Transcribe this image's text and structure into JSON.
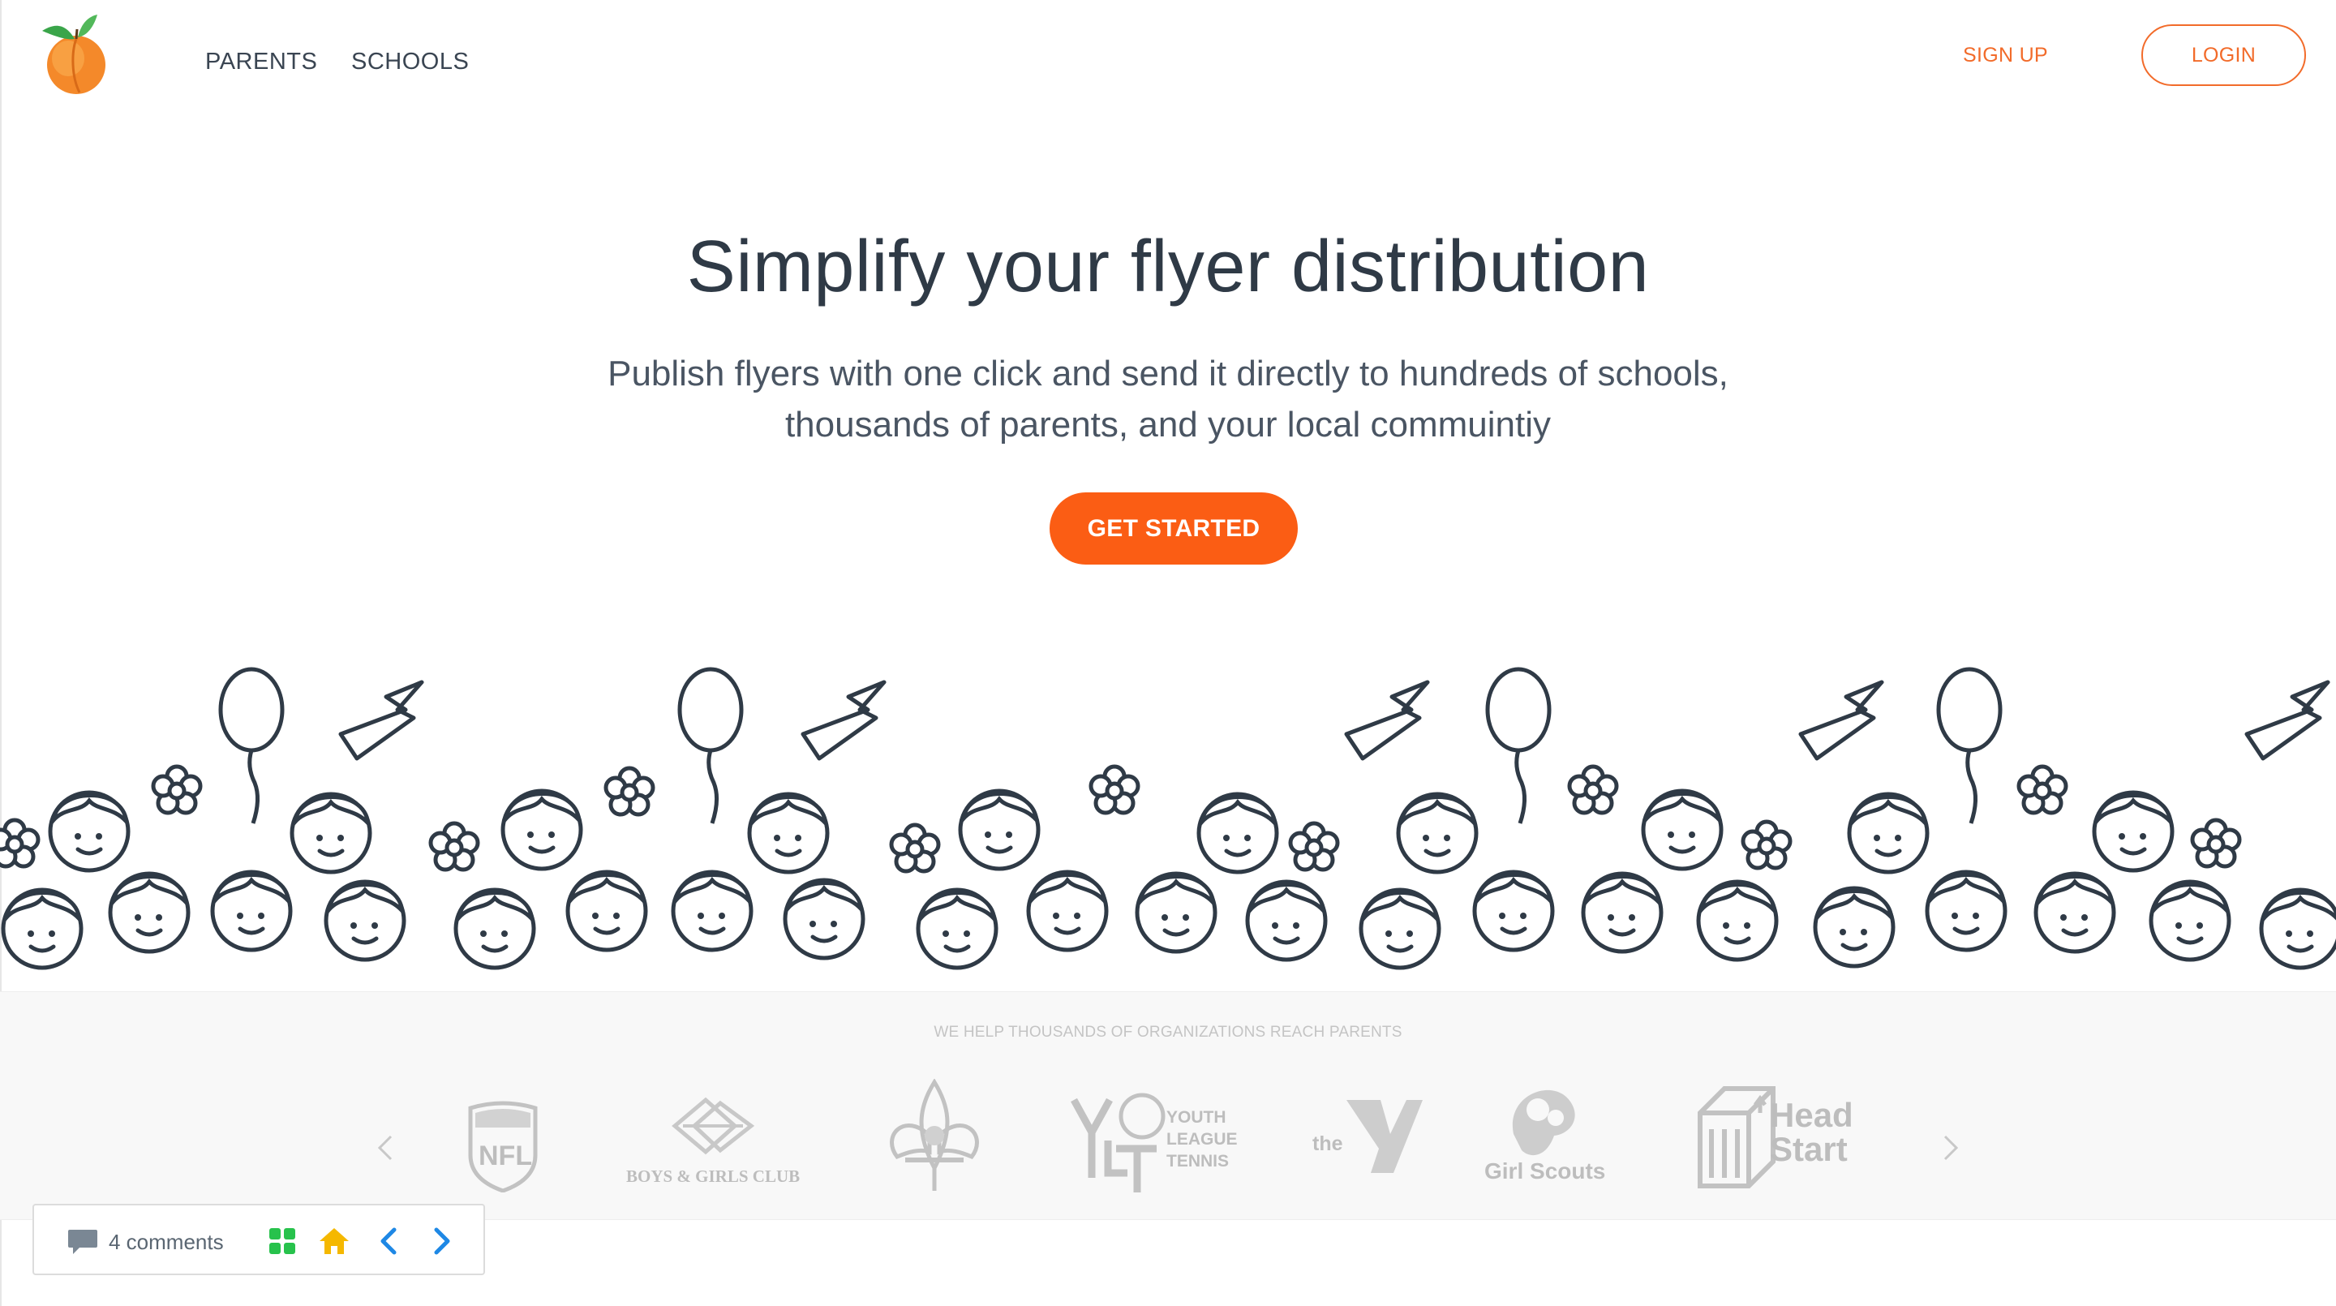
{
  "nav": {
    "links": [
      {
        "label": "PARENTS"
      },
      {
        "label": "SCHOOLS"
      }
    ],
    "signup_label": "SIGN UP",
    "login_label": "LOGIN"
  },
  "hero": {
    "title": "Simplify your flyer distribution",
    "subtitle_line1": "Publish flyers with one click and send it directly to hundreds of schools,",
    "subtitle_line2": "thousands of parents, and your local commuintiy",
    "cta_label": "GET STARTED"
  },
  "organizations": {
    "caption": "WE HELP THOUSANDS OF ORGANIZATIONS REACH PARENTS",
    "items": [
      {
        "text": "NFL"
      },
      {
        "text": "BOYS & GIRLS CLUB"
      },
      {
        "text": ""
      },
      {
        "text": "YOUTH LEAGUE TENNIS"
      },
      {
        "text": "the"
      },
      {
        "text": "Girl Scouts"
      },
      {
        "text": "Head Start"
      }
    ]
  },
  "comments_bar": {
    "count_label": "4 comments"
  },
  "colors": {
    "accent": "#fb5d14",
    "accent_outline": "#f26b2a",
    "text_dark": "#2f3a46",
    "logo_gray": "#c2c2c2",
    "tool_green": "#27c24c",
    "tool_yellow": "#f5b800",
    "tool_blue": "#1e88e5"
  },
  "icons": [
    "peach-logo-icon",
    "chevron-left-icon",
    "chevron-right-icon",
    "comment-bubble-icon",
    "grid-icon",
    "home-icon"
  ]
}
